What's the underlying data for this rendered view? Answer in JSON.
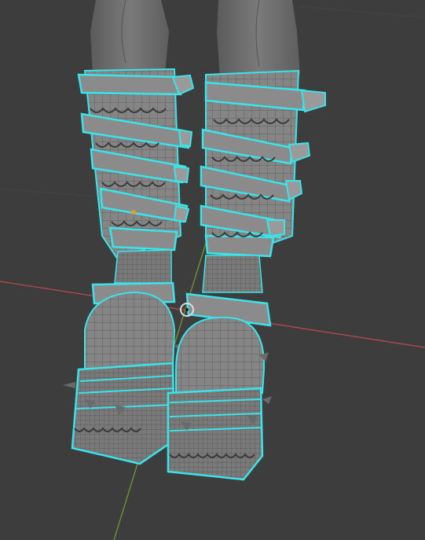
{
  "viewport": {
    "background": "#3d3d3d",
    "grid_line_color": "#464646",
    "x_axis_color": "#b8494f",
    "y_axis_color": "#6f9a30",
    "selection_outline_color": "#39e4ea",
    "mesh_color": "#858585",
    "leg_color": "#6f6f6f",
    "origin_point_color": "#e89a2a"
  },
  "scene": {
    "objects": [
      "legs",
      "left-boot",
      "right-boot"
    ],
    "selected_objects": [
      "left-boot",
      "right-boot"
    ],
    "mode": "wireframe-overlay"
  }
}
